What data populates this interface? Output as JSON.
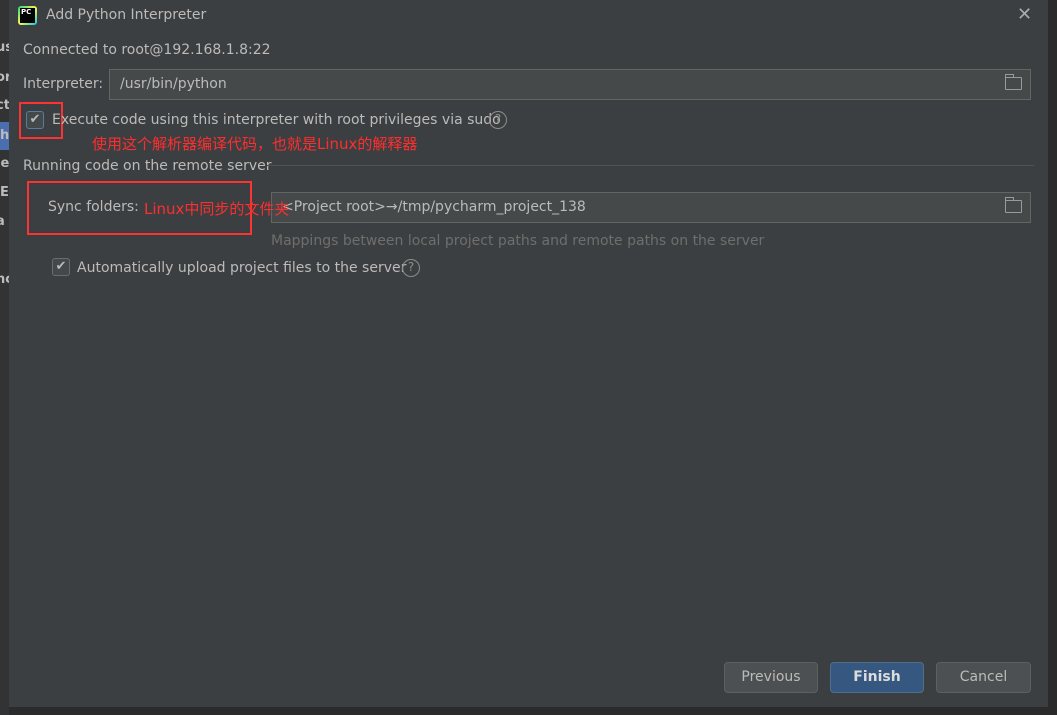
{
  "window": {
    "title": "Add Python Interpreter",
    "logo_text": "PC"
  },
  "behind_fragments": [
    "us",
    "or",
    "ct",
    "h",
    "je",
    "E",
    "a",
    "nc"
  ],
  "connection": "Connected to root@192.168.1.8:22",
  "interpreter": {
    "label": "Interpreter:",
    "value": "/usr/bin/python"
  },
  "sudo": {
    "label": "Execute code using this interpreter with root privileges via sudo",
    "checked": true
  },
  "annotation_1": "使用这个解析器编译代码，也就是Linux的解释器",
  "section_title": "Running code on the remote server",
  "sync": {
    "label": "Sync folders:",
    "value": "<Project root>→/tmp/pycharm_project_138",
    "hint": "Mappings between local project paths and remote paths on the server"
  },
  "annotation_2": "Linux中同步的文件夹",
  "auto_upload": {
    "label": "Automatically upload project files to the server",
    "checked": true
  },
  "buttons": {
    "previous": "Previous",
    "finish": "Finish",
    "cancel": "Cancel"
  },
  "colors": {
    "dialog_bg": "#3c3f41",
    "primary": "#365880",
    "annotation": "#ff2e2e"
  }
}
